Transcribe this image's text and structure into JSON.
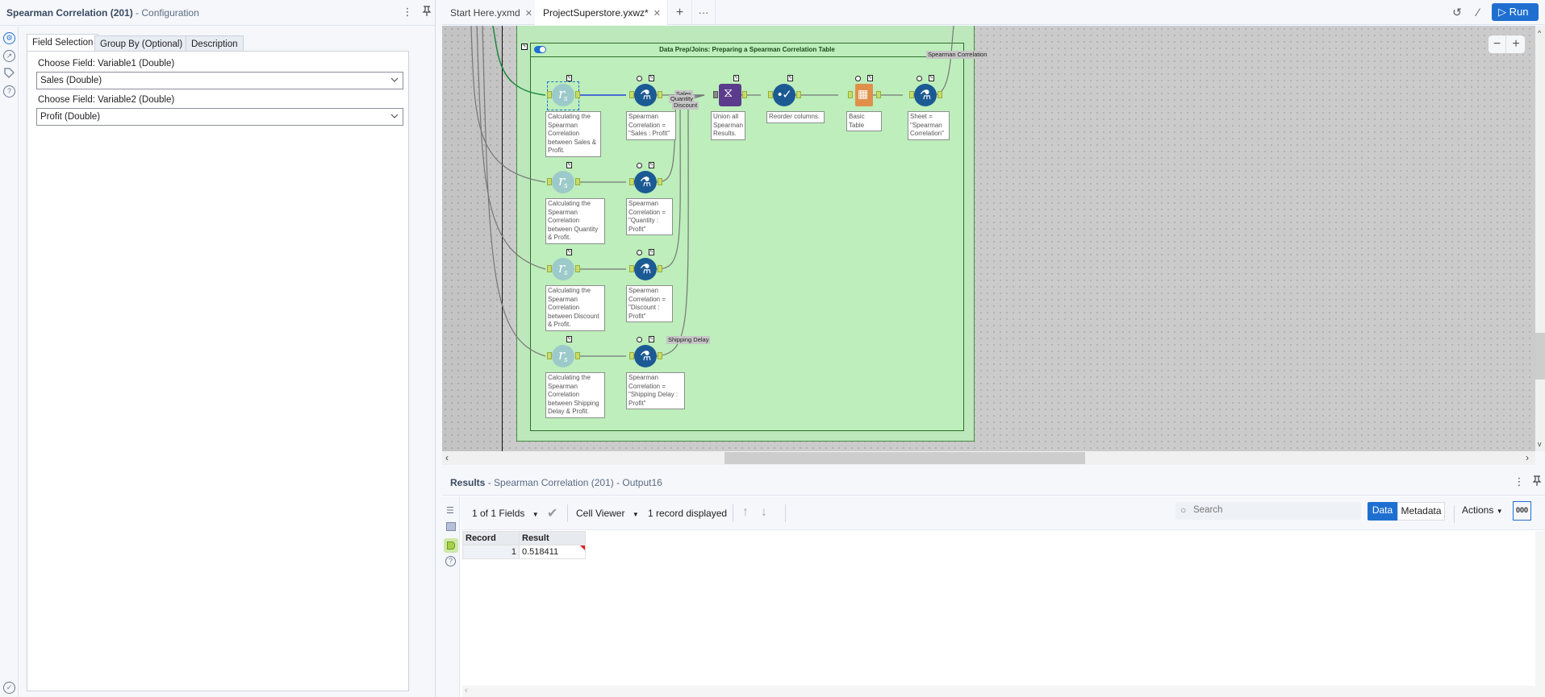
{
  "config": {
    "title_bold": "Spearman Correlation (201)",
    "title_sub": " - Configuration",
    "tabs": [
      "Field Selection",
      "Group By (Optional)",
      "Description"
    ],
    "active_tab": "Field Selection",
    "fields": [
      {
        "label": "Choose Field: Variable1 (Double)",
        "value": "Sales (Double)"
      },
      {
        "label": "Choose Field: Variable2 (Double)",
        "value": "Profit (Double)"
      }
    ],
    "rail_icons": [
      "gear-icon",
      "output-icon",
      "tag-icon",
      "help-icon"
    ]
  },
  "topbar": {
    "tabs": [
      {
        "label": "Start Here.yxmd",
        "active": false
      },
      {
        "label": "ProjectSuperstore.yxwz*",
        "active": true
      }
    ],
    "run_label": "Run"
  },
  "canvas": {
    "container_title": "Data Prep/Joins: Preparing a Spearman Correlation Table",
    "output_connection_label": "Spearman Correlation",
    "connection_labels": [
      "Sales",
      "Quantity",
      "Discount",
      "Shipping Delay"
    ],
    "rows": [
      {
        "corr_label": "Calculating the Spearman Correlation between Sales & Profit.",
        "formula_label": "Spearman Correlation = \"Sales : Profit\""
      },
      {
        "corr_label": "Calculating the Spearman Correlation between Quantity & Profit.",
        "formula_label": "Spearman Correlation = \"Quantity : Profit\""
      },
      {
        "corr_label": "Calculating the Spearman Correlation between Discount & Profit.",
        "formula_label": "Spearman Correlation = \"Discount : Profit\""
      },
      {
        "corr_label": "Calculating the Spearman Correlation between Shipping Delay & Profit.",
        "formula_label": "Spearman Correlation = \"Shipping Delay : Profit\""
      }
    ],
    "chain": [
      {
        "tool": "union",
        "label": "Union all Spearman Results."
      },
      {
        "tool": "select",
        "label": "Reorder columns."
      },
      {
        "tool": "table",
        "label": "Basic Table"
      },
      {
        "tool": "formula",
        "label": "Sheet = \"Spearman Correlation\""
      }
    ],
    "zoom_out": "−",
    "zoom_in": "+"
  },
  "results": {
    "title_bold": "Results",
    "title_sub": " - Spearman Correlation (201) - Output16",
    "fields_select": "1 of 1 Fields",
    "viewer_select": "Cell Viewer",
    "record_count": "1 record displayed",
    "search_placeholder": "Search",
    "data_btn": "Data",
    "metadata_btn": "Metadata",
    "actions_btn": "Actions",
    "format_btn": "000",
    "columns": [
      "Record",
      "Result"
    ],
    "rows": [
      [
        "1",
        "0.518411"
      ]
    ]
  },
  "colors": {
    "accent": "#1f6fd1",
    "container_fill": "#bdeebb",
    "formula_tool": "#1c5a94",
    "union_tool": "#5b3c8c",
    "table_tool": "#e0904a"
  }
}
